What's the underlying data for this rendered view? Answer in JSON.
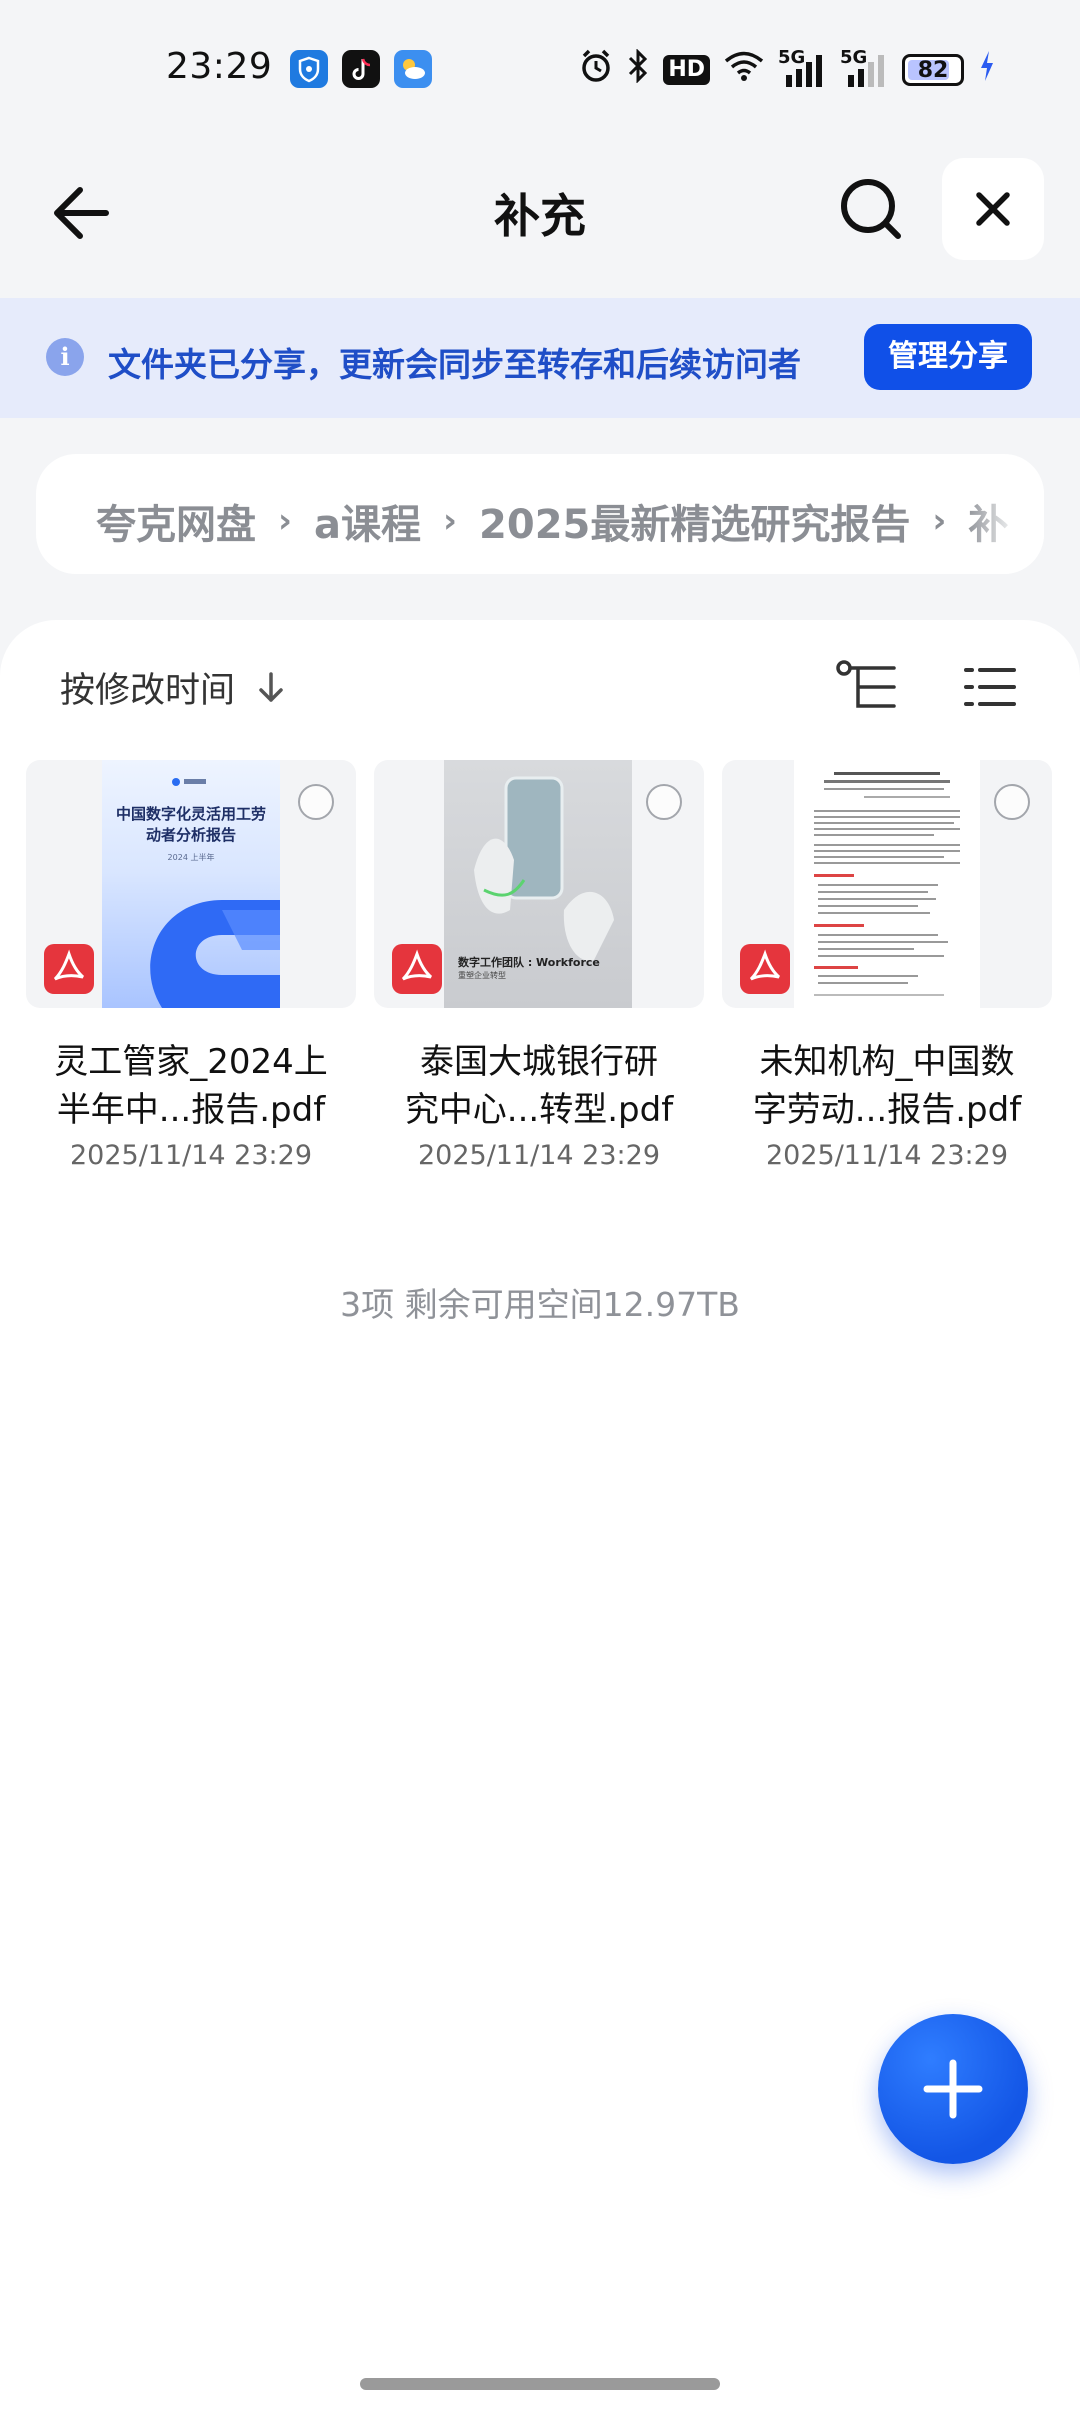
{
  "status_bar": {
    "time": "23:29",
    "apps": [
      "shield-app-icon",
      "tiktok-icon",
      "weather-icon"
    ],
    "icons": [
      "alarm-icon",
      "bluetooth-icon",
      "hd-voice-icon",
      "wifi-icon",
      "signal-5g-icon",
      "signal-5g-icon",
      "battery-icon",
      "charging-icon"
    ],
    "hd_label": "HD",
    "net1_label": "5G",
    "net2_label": "5G",
    "battery_level": "82",
    "battery_fraction": 0.82
  },
  "header": {
    "title": "补充",
    "back_icon": "arrow-left-icon",
    "search_icon": "search-icon",
    "close_icon": "close-icon"
  },
  "share_banner": {
    "text": "文件夹已分享，更新会同步至转存和后续访问者",
    "button_label": "管理分享",
    "icon": "info-icon",
    "icon_glyph": "i"
  },
  "breadcrumb": {
    "items": [
      "夸克网盘",
      "a课程",
      "2025最新精选研究报告",
      "补"
    ],
    "separator": "›"
  },
  "toolbar": {
    "sort_label": "按修改时间",
    "sort_icon": "arrow-down-icon",
    "tree_icon": "tree-view-icon",
    "list_icon": "list-view-icon"
  },
  "files": [
    {
      "name_line1": "灵工管家_2024上",
      "name_line2": "半年中...报告.pdf",
      "date": "2025/11/14 23:29",
      "preview_title": "中国数字化灵活用工劳动者分析报告",
      "preview_sub": "2024 上半年"
    },
    {
      "name_line1": "泰国大城银行研",
      "name_line2": "究中心...转型.pdf",
      "date": "2025/11/14 23:29",
      "preview_title": "数字工作团队 : Workforce",
      "preview_sub": "重塑企业转型"
    },
    {
      "name_line1": "未知机构_中国数",
      "name_line2": "字劳动...报告.pdf",
      "date": "2025/11/14 23:29"
    }
  ],
  "summary": "3项 剩余可用空间12.97TB",
  "fab": {
    "icon": "plus-icon"
  },
  "colors": {
    "accent": "#1050e8",
    "banner_bg": "#e6ebfb",
    "banner_text": "#1f4ec7",
    "pdf_red": "#e5353d"
  }
}
